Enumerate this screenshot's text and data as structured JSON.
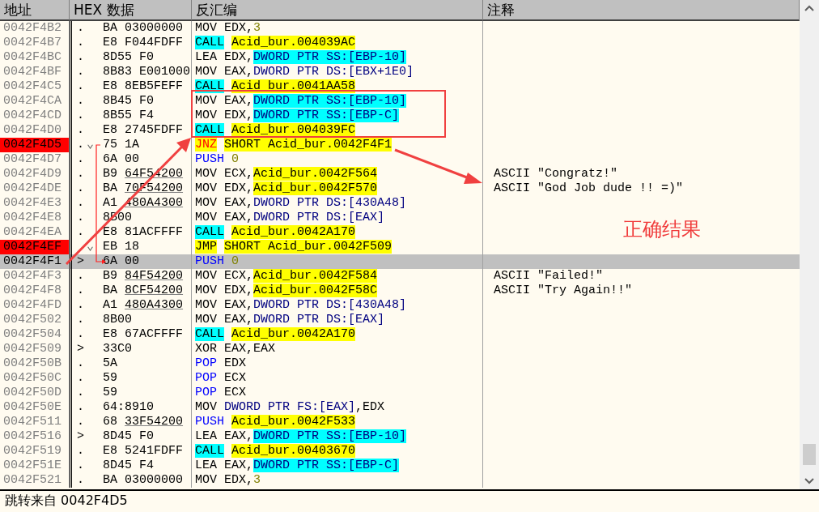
{
  "columns": [
    "地址",
    "HEX 数据",
    "反汇编",
    "注释"
  ],
  "rows": [
    {
      "address": "0042F4B2",
      "marker": ".",
      "hex": "BA 03000000",
      "breakpoint": false,
      "selected": false,
      "disasm": [
        {
          "text": "MOV EDX,",
          "kind": "plain"
        },
        {
          "text": "3",
          "kind": "const"
        }
      ]
    },
    {
      "address": "0042F4B7",
      "marker": ".",
      "hex": "E8 F044FDFF",
      "breakpoint": false,
      "selected": false,
      "disasm": [
        {
          "text": "CALL",
          "kind": "call"
        },
        {
          "text": "Acid_bur.004039AC",
          "kind": "label"
        }
      ]
    },
    {
      "address": "0042F4BC",
      "marker": ".",
      "hex": "8D55 F0",
      "breakpoint": false,
      "selected": false,
      "disasm": [
        {
          "text": "LEA EDX,",
          "kind": "plain"
        },
        {
          "text": "DWORD PTR SS:[EBP-10]",
          "kind": "stack"
        }
      ]
    },
    {
      "address": "0042F4BF",
      "marker": ".",
      "hex": "8B83 E001000",
      "breakpoint": false,
      "selected": false,
      "disasm": [
        {
          "text": "MOV EAX,",
          "kind": "plain"
        },
        {
          "text": "DWORD PTR DS:[EBX+1E0]",
          "kind": "memory"
        }
      ]
    },
    {
      "address": "0042F4C5",
      "marker": ".",
      "hex": "E8 8EB5FEFF",
      "breakpoint": false,
      "selected": false,
      "disasm": [
        {
          "text": "CALL",
          "kind": "call"
        },
        {
          "text": "Acid_bur.0041AA58",
          "kind": "label"
        }
      ]
    },
    {
      "address": "0042F4CA",
      "marker": ".",
      "hex": "8B45 F0",
      "breakpoint": false,
      "selected": false,
      "disasm": [
        {
          "text": "MOV EAX,",
          "kind": "plain"
        },
        {
          "text": "DWORD PTR SS:[EBP-10]",
          "kind": "stack"
        }
      ]
    },
    {
      "address": "0042F4CD",
      "marker": ".",
      "hex": "8B55 F4",
      "breakpoint": false,
      "selected": false,
      "disasm": [
        {
          "text": "MOV EDX,",
          "kind": "plain"
        },
        {
          "text": "DWORD PTR SS:[EBP-C]",
          "kind": "stack"
        }
      ]
    },
    {
      "address": "0042F4D0",
      "marker": ".",
      "hex": "E8 2745FDFF",
      "breakpoint": false,
      "selected": false,
      "disasm": [
        {
          "text": "CALL",
          "kind": "call"
        },
        {
          "text": "Acid_bur.004039FC",
          "kind": "label"
        }
      ]
    },
    {
      "address": "0042F4D5",
      "marker": ".",
      "jump": "⌄",
      "hex": "75 1A",
      "breakpoint": true,
      "selected": false,
      "disasm": [
        {
          "text": "JNZ",
          "kind": "cjump"
        },
        {
          "text": "SHORT Acid_bur.0042F4F1",
          "kind": "label"
        }
      ]
    },
    {
      "address": "0042F4D7",
      "marker": ".",
      "hex": "6A 00",
      "breakpoint": false,
      "selected": false,
      "disasm": [
        {
          "text": "PUSH",
          "kind": "stackop"
        },
        {
          "text": "0",
          "kind": "const"
        }
      ]
    },
    {
      "address": "0042F4D9",
      "marker": ".",
      "hex": "B9",
      "hex_arg": "64F54200",
      "hex_arg_underlined": true,
      "breakpoint": false,
      "selected": false,
      "disasm": [
        {
          "text": "MOV ECX,",
          "kind": "plain"
        },
        {
          "text": "Acid_bur.0042F564",
          "kind": "label"
        }
      ],
      "comment": "ASCII \"Congratz!\""
    },
    {
      "address": "0042F4DE",
      "marker": ".",
      "hex": "BA",
      "hex_arg": "70F54200",
      "hex_arg_underlined": true,
      "breakpoint": false,
      "selected": false,
      "disasm": [
        {
          "text": "MOV EDX,",
          "kind": "plain"
        },
        {
          "text": "Acid_bur.0042F570",
          "kind": "label"
        }
      ],
      "comment": "ASCII \"God Job dude !! =)\""
    },
    {
      "address": "0042F4E3",
      "marker": ".",
      "hex": "A1",
      "hex_arg": "480A4300",
      "hex_arg_underlined": true,
      "breakpoint": false,
      "selected": false,
      "disasm": [
        {
          "text": "MOV EAX,",
          "kind": "plain"
        },
        {
          "text": "DWORD PTR DS:[430A48]",
          "kind": "memory"
        }
      ]
    },
    {
      "address": "0042F4E8",
      "marker": ".",
      "hex": "8B00",
      "breakpoint": false,
      "selected": false,
      "disasm": [
        {
          "text": "MOV EAX,",
          "kind": "plain"
        },
        {
          "text": "DWORD PTR DS:[EAX]",
          "kind": "memory"
        }
      ]
    },
    {
      "address": "0042F4EA",
      "marker": ".",
      "hex": "E8 81ACFFFF",
      "breakpoint": false,
      "selected": false,
      "disasm": [
        {
          "text": "CALL",
          "kind": "call"
        },
        {
          "text": "Acid_bur.0042A170",
          "kind": "label"
        }
      ]
    },
    {
      "address": "0042F4EF",
      "jump": "⌄",
      "hex": "EB 18",
      "breakpoint": true,
      "selected": false,
      "disasm": [
        {
          "text": "JMP",
          "kind": "jump"
        },
        {
          "text": "SHORT Acid_bur.0042F509",
          "kind": "label"
        }
      ]
    },
    {
      "address": "0042F4F1",
      "marker": ">",
      "hex": "6A 00",
      "breakpoint": false,
      "selected": true,
      "disasm": [
        {
          "text": "PUSH",
          "kind": "stackop"
        },
        {
          "text": "0",
          "kind": "const"
        }
      ]
    },
    {
      "address": "0042F4F3",
      "marker": ".",
      "hex": "B9",
      "hex_arg": "84F54200",
      "hex_arg_underlined": true,
      "breakpoint": false,
      "selected": false,
      "disasm": [
        {
          "text": "MOV ECX,",
          "kind": "plain"
        },
        {
          "text": "Acid_bur.0042F584",
          "kind": "label"
        }
      ],
      "comment": "ASCII \"Failed!\""
    },
    {
      "address": "0042F4F8",
      "marker": ".",
      "hex": "BA",
      "hex_arg": "8CF54200",
      "hex_arg_underlined": true,
      "breakpoint": false,
      "selected": false,
      "disasm": [
        {
          "text": "MOV EDX,",
          "kind": "plain"
        },
        {
          "text": "Acid_bur.0042F58C",
          "kind": "label"
        }
      ],
      "comment": "ASCII \"Try Again!!\""
    },
    {
      "address": "0042F4FD",
      "marker": ".",
      "hex": "A1",
      "hex_arg": "480A4300",
      "hex_arg_underlined": true,
      "breakpoint": false,
      "selected": false,
      "disasm": [
        {
          "text": "MOV EAX,",
          "kind": "plain"
        },
        {
          "text": "DWORD PTR DS:[430A48]",
          "kind": "memory"
        }
      ]
    },
    {
      "address": "0042F502",
      "marker": ".",
      "hex": "8B00",
      "breakpoint": false,
      "selected": false,
      "disasm": [
        {
          "text": "MOV EAX,",
          "kind": "plain"
        },
        {
          "text": "DWORD PTR DS:[EAX]",
          "kind": "memory"
        }
      ]
    },
    {
      "address": "0042F504",
      "marker": ".",
      "hex": "E8 67ACFFFF",
      "breakpoint": false,
      "selected": false,
      "disasm": [
        {
          "text": "CALL",
          "kind": "call"
        },
        {
          "text": "Acid_bur.0042A170",
          "kind": "label"
        }
      ]
    },
    {
      "address": "0042F509",
      "marker": ">",
      "hex": "33C0",
      "breakpoint": false,
      "selected": false,
      "disasm": [
        {
          "text": "XOR EAX,EAX",
          "kind": "plain"
        }
      ]
    },
    {
      "address": "0042F50B",
      "marker": ".",
      "hex": "5A",
      "breakpoint": false,
      "selected": false,
      "disasm": [
        {
          "text": "POP",
          "kind": "stackop"
        },
        {
          "text": " EDX",
          "kind": "plain"
        }
      ]
    },
    {
      "address": "0042F50C",
      "marker": ".",
      "hex": "59",
      "breakpoint": false,
      "selected": false,
      "disasm": [
        {
          "text": "POP",
          "kind": "stackop"
        },
        {
          "text": " ECX",
          "kind": "plain"
        }
      ]
    },
    {
      "address": "0042F50D",
      "marker": ".",
      "hex": "59",
      "breakpoint": false,
      "selected": false,
      "disasm": [
        {
          "text": "POP",
          "kind": "stackop"
        },
        {
          "text": " ECX",
          "kind": "plain"
        }
      ]
    },
    {
      "address": "0042F50E",
      "marker": ".",
      "hex": "64:8910",
      "breakpoint": false,
      "selected": false,
      "disasm": [
        {
          "text": "MOV ",
          "kind": "plain"
        },
        {
          "text": "DWORD PTR FS:[EAX]",
          "kind": "memory"
        },
        {
          "text": ",EDX",
          "kind": "plain"
        }
      ]
    },
    {
      "address": "0042F511",
      "marker": ".",
      "hex": "68",
      "hex_arg": "33F54200",
      "hex_arg_underlined": true,
      "breakpoint": false,
      "selected": false,
      "disasm": [
        {
          "text": "PUSH",
          "kind": "stackop"
        },
        {
          "text": "Acid_bur.0042F533",
          "kind": "label"
        }
      ]
    },
    {
      "address": "0042F516",
      "marker": ">",
      "hex": "8D45 F0",
      "breakpoint": false,
      "selected": false,
      "disasm": [
        {
          "text": "LEA EAX,",
          "kind": "plain"
        },
        {
          "text": "DWORD PTR SS:[EBP-10]",
          "kind": "stack"
        }
      ]
    },
    {
      "address": "0042F519",
      "marker": ".",
      "hex": "E8 5241FDFF",
      "breakpoint": false,
      "selected": false,
      "disasm": [
        {
          "text": "CALL",
          "kind": "call"
        },
        {
          "text": "Acid_bur.00403670",
          "kind": "label"
        }
      ]
    },
    {
      "address": "0042F51E",
      "marker": ".",
      "hex": "8D45 F4",
      "breakpoint": false,
      "selected": false,
      "disasm": [
        {
          "text": "LEA EAX,",
          "kind": "plain"
        },
        {
          "text": "DWORD PTR SS:[EBP-C]",
          "kind": "stack"
        }
      ]
    },
    {
      "address": "0042F521",
      "marker": ".",
      "hex": "BA 03000000",
      "breakpoint": false,
      "selected": false,
      "disasm": [
        {
          "text": "MOV EDX,",
          "kind": "plain"
        },
        {
          "text": "3",
          "kind": "const"
        }
      ]
    }
  ],
  "status_bar": "跳转来自 0042F4D5",
  "annotation": {
    "label": "正确结果"
  }
}
